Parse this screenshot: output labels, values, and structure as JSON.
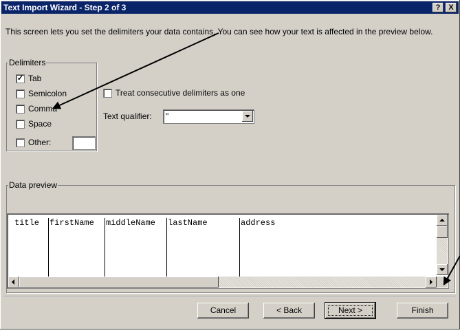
{
  "window": {
    "title": "Text Import Wizard - Step 2 of 3",
    "help_label": "?",
    "close_label": "X"
  },
  "description": "This screen lets you set the delimiters your data contains.  You can see how your text is affected in the preview below.",
  "delimiters": {
    "legend": "Delimiters",
    "items": [
      {
        "label": "Tab",
        "checked": true
      },
      {
        "label": "Semicolon",
        "checked": false
      },
      {
        "label": "Comma",
        "checked": false
      },
      {
        "label": "Space",
        "checked": false
      },
      {
        "label": "Other:",
        "checked": false
      }
    ],
    "other_value": ""
  },
  "options": {
    "consecutive_label": "Treat consecutive delimiters as one",
    "consecutive_checked": false,
    "qualifier_label": "Text qualifier:",
    "qualifier_value": "\""
  },
  "preview": {
    "legend": "Data preview",
    "columns": [
      "title",
      "firstName",
      "middleName",
      "lastName",
      "address"
    ]
  },
  "buttons": {
    "cancel": "Cancel",
    "back": "< Back",
    "next": "Next >",
    "finish": "Finish"
  },
  "colors": {
    "titlebar": "#0a246a",
    "dialog_face": "#d4d0c8"
  }
}
